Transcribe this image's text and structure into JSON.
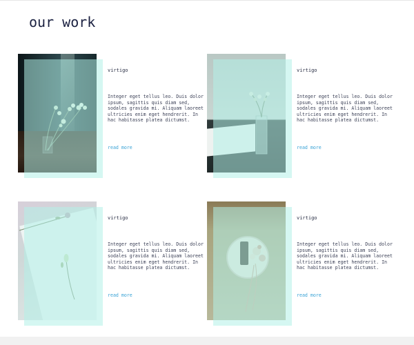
{
  "page": {
    "title": "our work"
  },
  "cards": [
    {
      "title": "virtigo",
      "text": "Integer eget tellus leo. Duis dolor ipsum, sagittis quis diam sed, sodales gravida mi. Aliquam laoreet ultricies enim eget hendrerit. In hac habitasse platea dictumst.",
      "link": "read more",
      "image": "flowers-on-wooden-floor-photo"
    },
    {
      "title": "virtigo",
      "text": "Integer eget tellus leo. Duis dolor ipsum, sagittis quis diam sed, sodales gravida mi. Aliquam laoreet ultricies enim eget hendrerit. In hac habitasse platea dictumst.",
      "link": "read more",
      "image": "flowers-in-glass-vase-photo"
    },
    {
      "title": "virtigo",
      "text": "Integer eget tellus leo. Duis dolor ipsum, sagittis quis diam sed, sodales gravida mi. Aliquam laoreet ultricies enim eget hendrerit. In hac habitasse platea dictumst.",
      "link": "read more",
      "image": "flowers-on-paper-photo"
    },
    {
      "title": "virtigo",
      "text": "Integer eget tellus leo. Duis dolor ipsum, sagittis quis diam sed, sodales gravida mi. Aliquam laoreet ultricies enim eget hendrerit. In hac habitasse platea dictumst.",
      "link": "read more",
      "image": "dried-flowers-on-plate-photo"
    }
  ],
  "colors": {
    "title": "#1b2141",
    "link": "#3aa3d6",
    "overlay": "#b2f0e8"
  }
}
